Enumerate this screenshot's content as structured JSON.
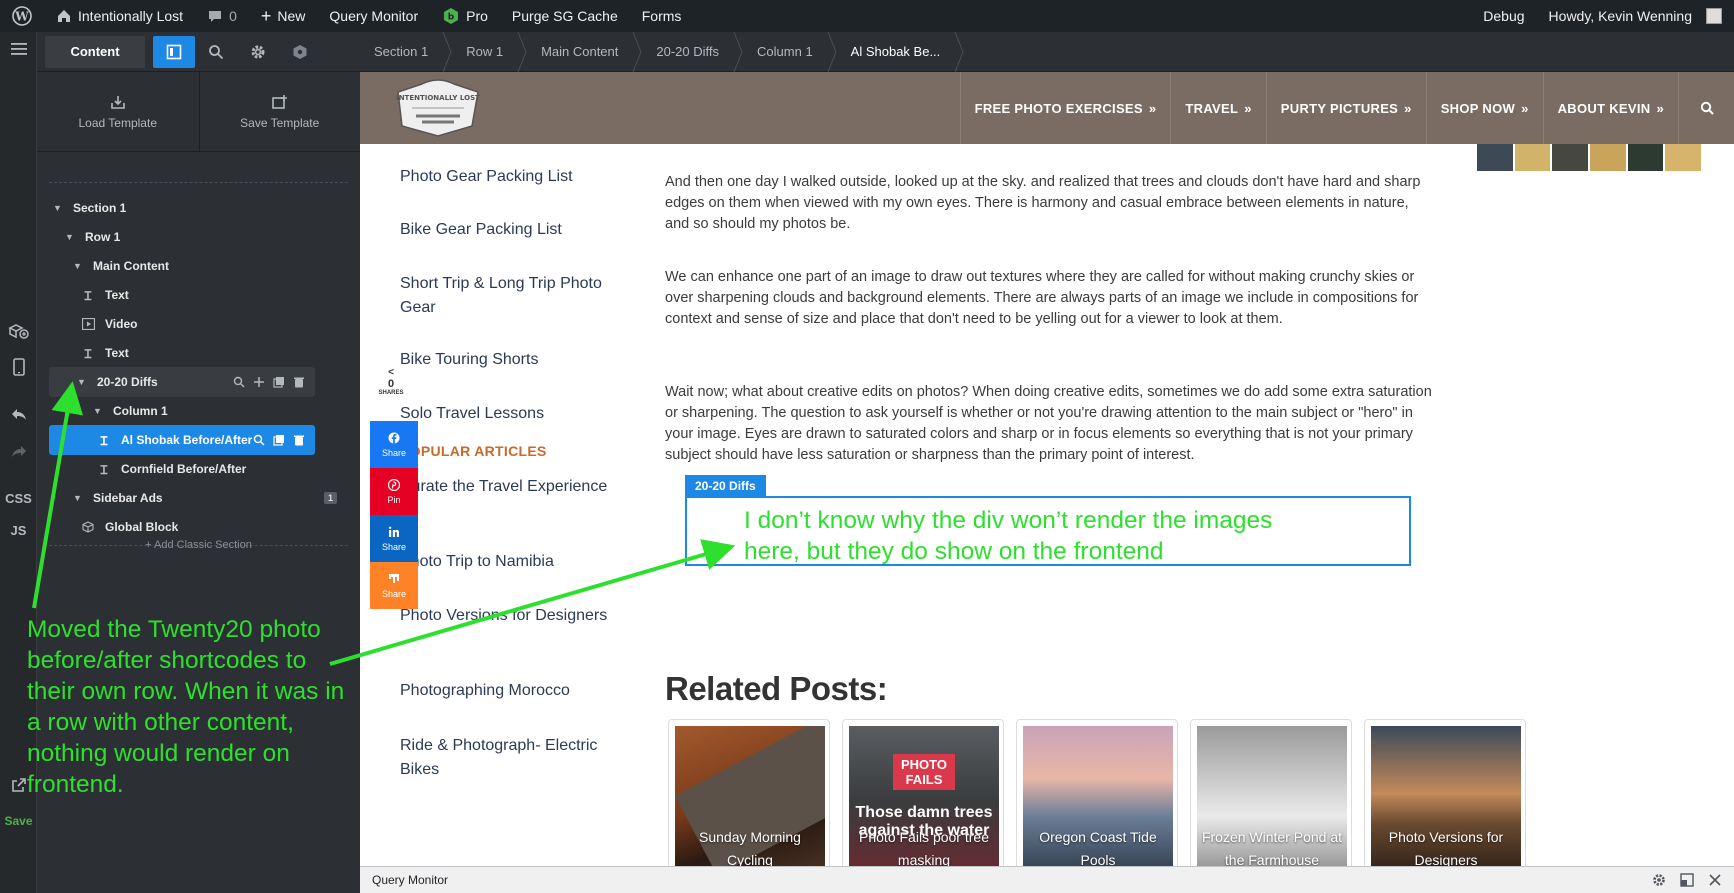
{
  "adminbar": {
    "site_name": "Intentionally Lost",
    "comments_count": "0",
    "new_label": "New",
    "query_monitor": "Query Monitor",
    "pro_label": "Pro",
    "purge_label": "Purge SG Cache",
    "forms_label": "Forms",
    "debug_label": "Debug",
    "howdy": "Howdy, Kevin Wenning"
  },
  "rail": {
    "css": "CSS",
    "js": "JS",
    "save": "Save"
  },
  "panel": {
    "tab_content": "Content",
    "load_template": "Load Template",
    "save_template": "Save Template",
    "tree": [
      {
        "label": "Section 1"
      },
      {
        "label": "Row 1"
      },
      {
        "label": "Main Content"
      },
      {
        "label": "Text"
      },
      {
        "label": "Video"
      },
      {
        "label": "Text"
      },
      {
        "label": "20-20 Diffs"
      },
      {
        "label": "Column 1"
      },
      {
        "label": "Al Shobak Before/After"
      },
      {
        "label": "Cornfield Before/After"
      },
      {
        "label": "Sidebar Ads",
        "badge": "1"
      },
      {
        "label": "Global Block"
      }
    ],
    "add_classic": "+ Add Classic Section"
  },
  "breadcrumbs": [
    "Section 1",
    "Row 1",
    "Main Content",
    "20-20 Diffs",
    "Column 1",
    "Al Shobak Be..."
  ],
  "site": {
    "logo_text": "INTENTIONALLY LOST",
    "nav": [
      "FREE PHOTO EXERCISES",
      "TRAVEL",
      "PURTY PICTURES",
      "SHOP NOW",
      "ABOUT KEVIN"
    ],
    "sidebar_links": [
      "Photo Gear Packing List",
      "Bike Gear Packing List",
      "Short Trip & Long Trip Photo Gear",
      "Bike Touring Shorts",
      "Solo Travel Lessons",
      "POPULAR ARTICLES",
      "Curate the Travel Experience",
      "Photo Trip to Namibia",
      "Photo Versions for Designers",
      "Photographing Morocco",
      "Ride & Photograph- Electric Bikes"
    ],
    "share": {
      "count": "0",
      "count_label": "SHARES",
      "buttons": [
        {
          "label": "Share",
          "icon": "facebook-icon",
          "color": "#1877f2"
        },
        {
          "label": "Pin",
          "icon": "pinterest-icon",
          "color": "#e60023"
        },
        {
          "label": "Share",
          "icon": "linkedin-icon",
          "color": "#0a66c2"
        },
        {
          "label": "Share",
          "icon": "mix-icon",
          "color": "#ff8226"
        }
      ]
    },
    "paragraphs": [
      "And then one day I walked outside, looked up at the sky. and realized that trees and clouds don't have hard and sharp edges on them when viewed with my own eyes. There is harmony and casual embrace between elements in nature, and so should my photos be.",
      "We can enhance one part of an image to draw out textures where they are called for without making crunchy skies or over sharpening clouds and background elements. There are always parts of an image we include in compositions for context and sense of size and place that don't need to be yelling out for a viewer to look at them.",
      "Wait now; what about creative edits on photos? When doing creative edits, sometimes we do add some extra saturation or sharpening. The question to ask yourself is whether or not you're drawing attention to the main subject or \"hero\" in your image. Eyes are drawn to saturated colors and sharp or in focus elements so everything that is not your primary subject should have less saturation or sharpness than the primary point of interest."
    ],
    "module_tag": "20-20 Diffs",
    "related_title": "Related Posts:",
    "related": [
      {
        "caption": "Sunday Morning Cycling"
      },
      {
        "caption": "Photo Fails poor tree masking",
        "logo": "PHOTO FAILS",
        "overlay": "Those damn trees against the water"
      },
      {
        "caption": "Oregon Coast Tide Pools"
      },
      {
        "caption": "Frozen Winter Pond at the Farmhouse"
      },
      {
        "caption": "Photo Versions for Designers"
      }
    ]
  },
  "querymonitor": {
    "title": "Query Monitor"
  },
  "annotations": {
    "left_note": "Moved the Twenty20 photo before/after shortcodes to their own row. When it was in a row with other content, nothing would render on frontend.",
    "box_note": "I don’t know why the div won’t render the images here, but they do show on the frontend",
    "color": "#2ee02e"
  }
}
